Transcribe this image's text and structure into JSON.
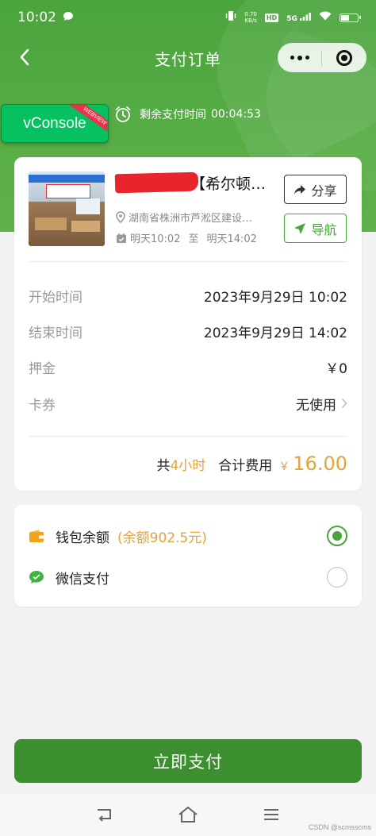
{
  "status_bar": {
    "time": "10:02",
    "net_speed_value": "0.70",
    "net_speed_unit": "KB/s",
    "hd_badge": "HD",
    "network": "5G"
  },
  "nav": {
    "title": "支付订单"
  },
  "vconsole": {
    "label": "vConsole",
    "ribbon": "WEBVIEW"
  },
  "timer": {
    "label": "剩余支付时间",
    "remaining": "00:04:53"
  },
  "order": {
    "shop_name": "【希尔顿…",
    "address": "湖南省株洲市芦淞区建设…",
    "start_short": "明天10:02",
    "period_sep": "至",
    "end_short": "明天14:02",
    "share_label": "分享",
    "navigate_label": "导航",
    "fields": [
      {
        "label": "开始时间",
        "value": "2023年9月29日 10:02"
      },
      {
        "label": "结束时间",
        "value": "2023年9月29日 14:02"
      },
      {
        "label": "押金",
        "value": "￥0"
      },
      {
        "label": "卡券",
        "value": "无使用"
      }
    ],
    "total": {
      "prefix": "共",
      "hours": "4小时",
      "label": "合计费用",
      "currency": "￥",
      "amount": "16.00"
    }
  },
  "payment": {
    "wallet_label": "钱包余额",
    "wallet_balance": "(余额902.5元)",
    "wechat_label": "微信支付",
    "selected": "wallet"
  },
  "pay_button": "立即支付",
  "watermark": "CSDN @scmsscms",
  "colors": {
    "brand_green": "#4aa43c",
    "button_green": "#3b8f2f",
    "accent_orange": "#e6a23c",
    "vconsole_green": "#07c160"
  }
}
